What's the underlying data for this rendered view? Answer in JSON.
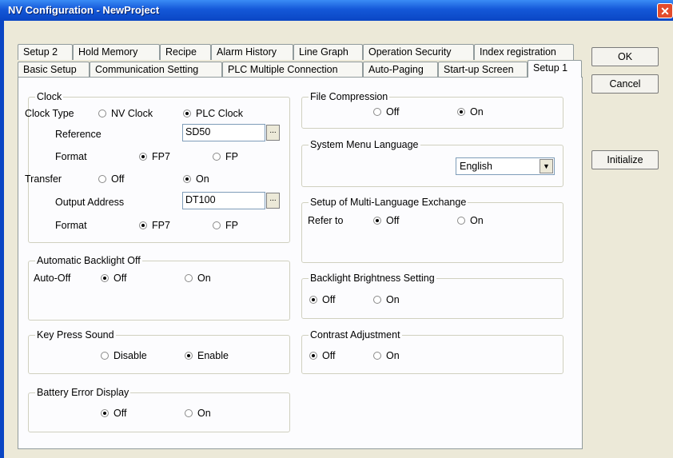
{
  "window": {
    "title": "NV Configuration - NewProject",
    "close_icon": "close-icon"
  },
  "tabs_top": [
    "Setup 2",
    "Hold Memory",
    "Recipe",
    "Alarm History",
    "Line Graph",
    "Operation Security",
    "Index registration"
  ],
  "tabs_bottom": [
    "Basic Setup",
    "Communication Setting",
    "PLC Multiple Connection",
    "Auto-Paging",
    "Start-up Screen",
    "Setup 1"
  ],
  "active_tab": "Setup 1",
  "buttons": {
    "ok": "OK",
    "cancel": "Cancel",
    "initialize": "Initialize"
  },
  "clock": {
    "legend": "Clock",
    "clock_type_label": "Clock Type",
    "nv_clock": "NV Clock",
    "plc_clock": "PLC Clock",
    "selected": "PLC Clock",
    "reference_label": "Reference",
    "reference_value": "SD50",
    "format_label": "Format",
    "fp7": "FP7",
    "fp": "FP",
    "format_selected": "FP7",
    "transfer_label": "Transfer",
    "off": "Off",
    "on": "On",
    "transfer_selected": "On",
    "output_address_label": "Output Address",
    "output_address_value": "DT100",
    "format2_label": "Format",
    "format2_selected": "FP7",
    "browse": "..."
  },
  "backlight_off": {
    "legend": "Automatic Backlight Off",
    "label": "Auto-Off",
    "off": "Off",
    "on": "On",
    "selected": "Off"
  },
  "key_press": {
    "legend": "Key Press Sound",
    "disable": "Disable",
    "enable": "Enable",
    "selected": "Enable"
  },
  "battery": {
    "legend": "Battery Error Display",
    "off": "Off",
    "on": "On",
    "selected": "Off"
  },
  "file_compression": {
    "legend": "File Compression",
    "off": "Off",
    "on": "On",
    "selected": "On"
  },
  "system_menu_language": {
    "legend": "System Menu Language",
    "value": "English"
  },
  "multi_language": {
    "legend": "Setup of Multi-Language Exchange",
    "label": "Refer to",
    "off": "Off",
    "on": "On",
    "selected": "Off"
  },
  "backlight_brightness": {
    "legend": "Backlight Brightness Setting",
    "off": "Off",
    "on": "On",
    "selected": "Off"
  },
  "contrast": {
    "legend": "Contrast Adjustment",
    "off": "Off",
    "on": "On",
    "selected": "Off"
  }
}
